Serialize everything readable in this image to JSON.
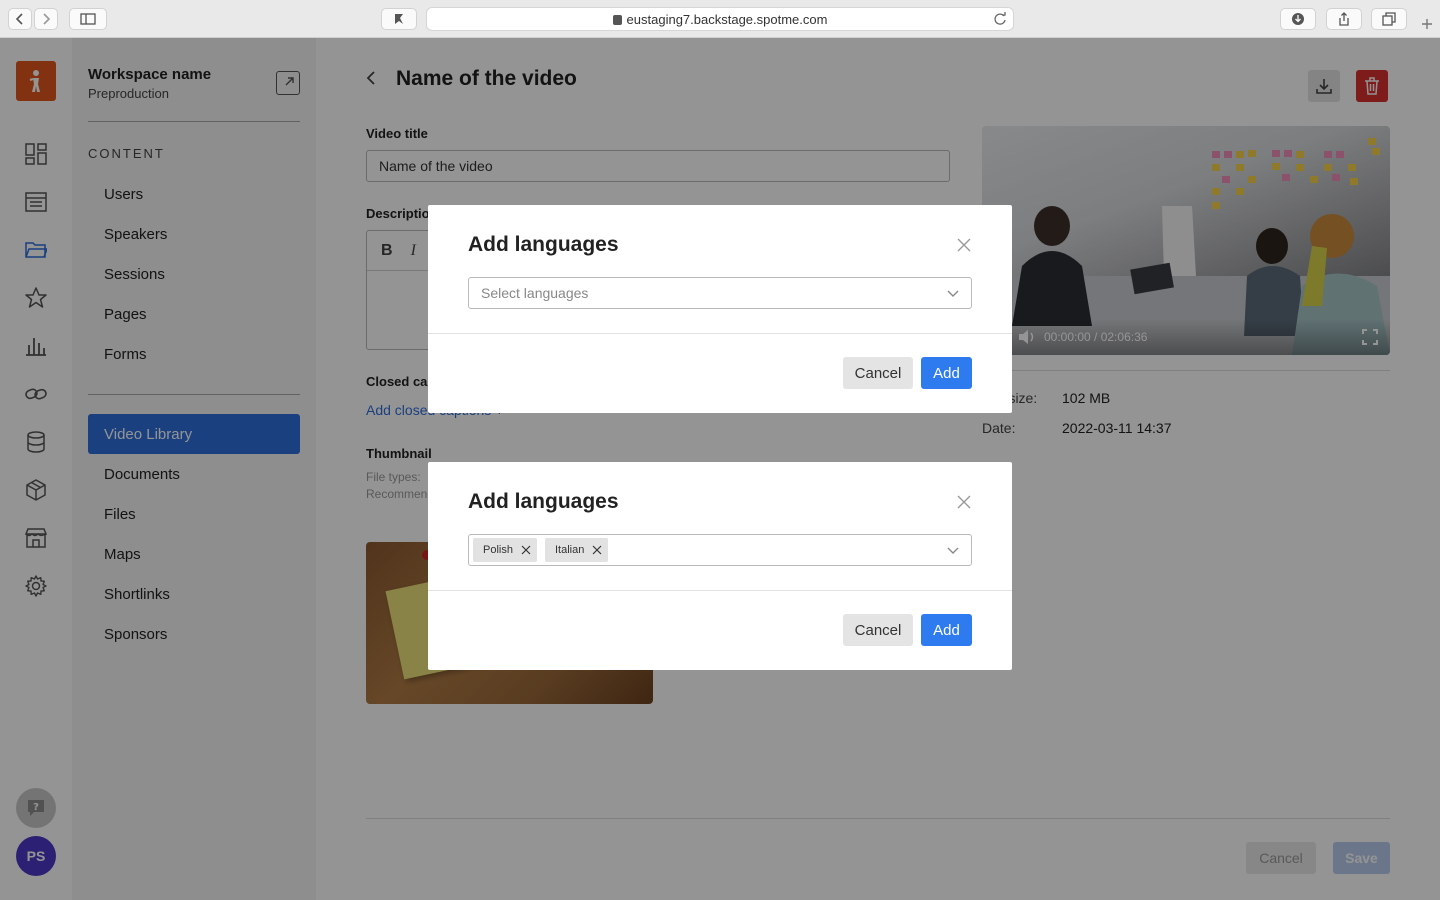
{
  "browser": {
    "url": "eustaging7.backstage.spotme.com"
  },
  "rail": {
    "icons": [
      "dashboard-icon",
      "list-icon",
      "folder-icon",
      "star-icon",
      "chart-icon",
      "link-icon",
      "database-icon",
      "box-icon",
      "store-icon",
      "gear-icon"
    ],
    "avatar_initials": "PS"
  },
  "sidebar": {
    "workspace_name": "Workspace name",
    "workspace_sub": "Preproduction",
    "section": "CONTENT",
    "items_group1": [
      {
        "label": "Users"
      },
      {
        "label": "Speakers"
      },
      {
        "label": "Sessions"
      },
      {
        "label": "Pages"
      },
      {
        "label": "Forms"
      }
    ],
    "items_group2": [
      {
        "label": "Video Library",
        "active": true
      },
      {
        "label": "Documents"
      },
      {
        "label": "Files"
      },
      {
        "label": "Maps"
      },
      {
        "label": "Shortlinks"
      },
      {
        "label": "Sponsors"
      }
    ]
  },
  "main": {
    "title": "Name of the video",
    "video_title_label": "Video title",
    "video_title_value": "Name of the video",
    "description_label": "Description",
    "closed_captions_label": "Closed captions",
    "add_captions_link": "Add closed captions +",
    "thumbnail_label": "Thumbnail",
    "file_types": "File types:",
    "recommended": "Recommended:",
    "video_time": "00:00:00 / 02:06:36",
    "meta": [
      {
        "key": "File size:",
        "value": "102 MB"
      },
      {
        "key": "Date:",
        "value": "2022-03-11 14:37"
      }
    ],
    "footer_cancel": "Cancel",
    "footer_save": "Save"
  },
  "modal_empty": {
    "title": "Add languages",
    "placeholder": "Select languages",
    "cancel": "Cancel",
    "add": "Add"
  },
  "modal_filled": {
    "title": "Add languages",
    "tags": [
      "Polish",
      "Italian"
    ],
    "cancel": "Cancel",
    "add": "Add"
  },
  "colors": {
    "accent": "#2e7bf0",
    "active_nav": "#2e6fdd",
    "danger": "#d93131",
    "logo": "#e2571e",
    "avatar": "#4a38c8"
  }
}
